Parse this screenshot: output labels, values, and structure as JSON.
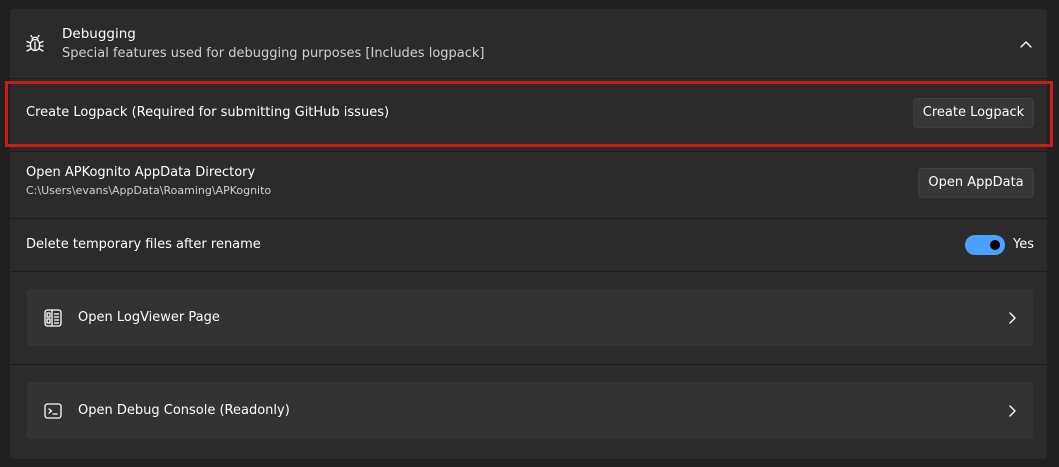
{
  "expander": {
    "icon": "bug-icon",
    "title": "Debugging",
    "subtitle": "Special features used for debugging purposes [Includes logpack]",
    "expanded": true
  },
  "logpack": {
    "label": "Create Logpack (Required for submitting GitHub issues)",
    "button_label": "Create Logpack",
    "highlighted": true
  },
  "appdata": {
    "label": "Open APKognito AppData Directory",
    "path": "C:\\Users\\evans\\AppData\\Roaming\\APKognito",
    "button_label": "Open AppData"
  },
  "temp_files": {
    "label": "Delete temporary files after rename",
    "toggle_on": true,
    "toggle_label": "Yes"
  },
  "cards": [
    {
      "icon": "log-viewer-icon",
      "label": "Open LogViewer Page"
    },
    {
      "icon": "console-icon",
      "label": "Open Debug Console (Readonly)"
    }
  ],
  "colors": {
    "accent": "#4ca0ff",
    "highlight": "#d01b1b",
    "panel": "#2b2b2b",
    "card": "#333333"
  }
}
